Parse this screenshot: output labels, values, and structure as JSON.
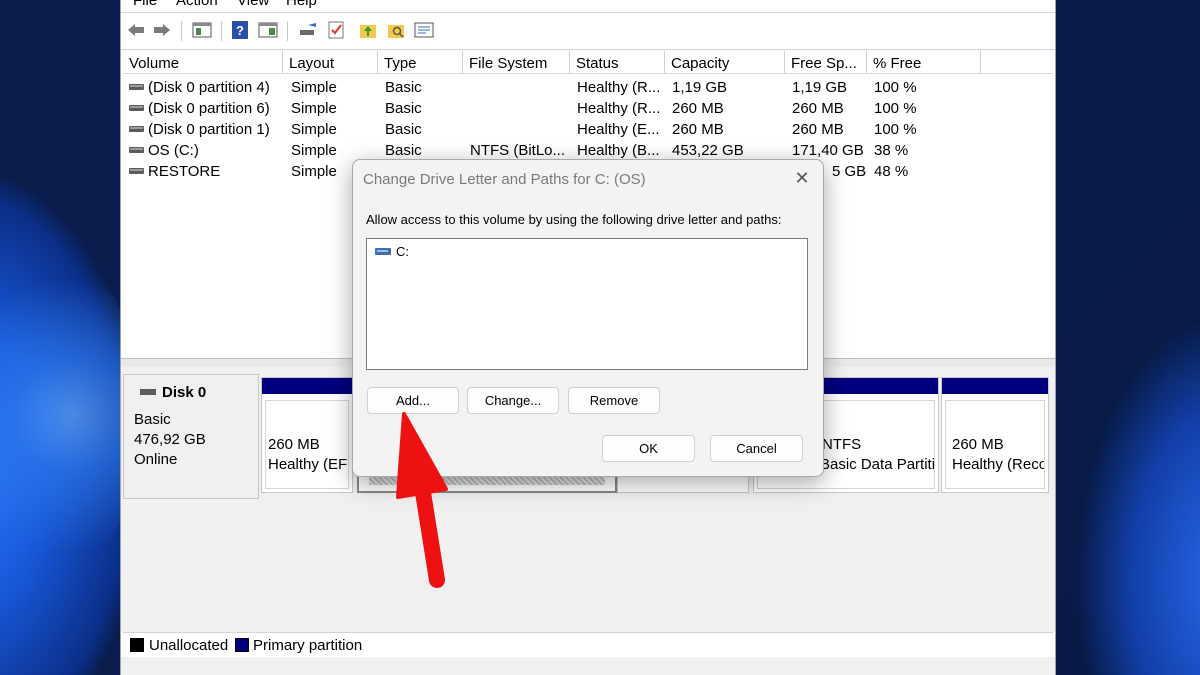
{
  "menu": [
    "File",
    "Action",
    "View",
    "Help"
  ],
  "columns": [
    "Volume",
    "Layout",
    "Type",
    "File System",
    "Status",
    "Capacity",
    "Free Sp...",
    "% Free"
  ],
  "volumes": [
    {
      "volume": "(Disk 0 partition 4)",
      "layout": "Simple",
      "type": "Basic",
      "fs": "",
      "status": "Healthy (R...",
      "capacity": "1,19 GB",
      "free": "1,19 GB",
      "pct": "100 %"
    },
    {
      "volume": "(Disk 0 partition 6)",
      "layout": "Simple",
      "type": "Basic",
      "fs": "",
      "status": "Healthy (R...",
      "capacity": "260 MB",
      "free": "260 MB",
      "pct": "100 %"
    },
    {
      "volume": "(Disk 0 partition 1)",
      "layout": "Simple",
      "type": "Basic",
      "fs": "",
      "status": "Healthy (E...",
      "capacity": "260 MB",
      "free": "260 MB",
      "pct": "100 %"
    },
    {
      "volume": "OS (C:)",
      "layout": "Simple",
      "type": "Basic",
      "fs": "NTFS (BitLo...",
      "status": "Healthy (B...",
      "capacity": "453,22 GB",
      "free": "171,40 GB",
      "pct": "38 %"
    },
    {
      "volume": "RESTORE",
      "layout": "Simple",
      "type": "",
      "fs": "",
      "status": "",
      "capacity": "",
      "free": "5 GB",
      "pct": "48 %"
    }
  ],
  "disk": {
    "name": "Disk 0",
    "type": "Basic",
    "size": "476,92 GB",
    "state": "Online"
  },
  "partitions": [
    {
      "size": "260 MB",
      "desc": "Healthy (EFI"
    },
    {
      "size": "NTFS",
      "desc": "Basic Data Partitio"
    },
    {
      "size": "260 MB",
      "desc": "Healthy (Reco"
    }
  ],
  "legend": [
    "Unallocated",
    "Primary partition"
  ],
  "dialog": {
    "title": "Change Drive Letter and Paths for C: (OS)",
    "close": "✕",
    "description": "Allow access to this volume by using the following drive letter and paths:",
    "entry": "C:",
    "add": "Add...",
    "change": "Change...",
    "remove": "Remove",
    "ok": "OK",
    "cancel": "Cancel"
  },
  "colors": {
    "primary_partition": "#00007f",
    "unallocated": "#000000",
    "annotation_arrow": "#ee1111"
  }
}
